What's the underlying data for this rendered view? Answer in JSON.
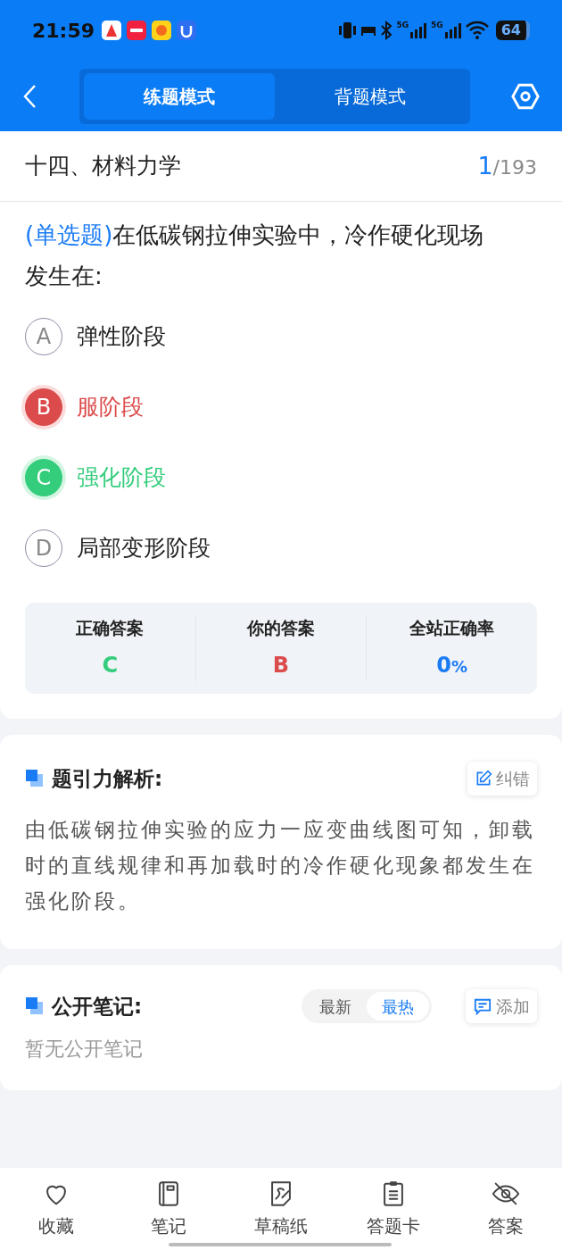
{
  "status_bar": {
    "time": "21:59",
    "signals": [
      "5G",
      "5G"
    ],
    "battery": "64"
  },
  "header": {
    "tabs": [
      {
        "label": "练题模式",
        "selected": true
      },
      {
        "label": "背题模式",
        "selected": false
      }
    ]
  },
  "section": {
    "title": "十四、材料力学",
    "current": "1",
    "total": "/193"
  },
  "question": {
    "type": "(单选题)",
    "text": "在低碳钢拉伸实验中，冷作硬化现场发生在:",
    "options": [
      {
        "letter": "A",
        "text": "弹性阶段",
        "kind": "normal"
      },
      {
        "letter": "B",
        "text": "服阶段",
        "kind": "wrong"
      },
      {
        "letter": "C",
        "text": "强化阶段",
        "kind": "correct"
      },
      {
        "letter": "D",
        "text": "局部变形阶段",
        "kind": "normal"
      }
    ]
  },
  "summary": [
    {
      "label": "正确答案",
      "value": "C",
      "kind": "correct"
    },
    {
      "label": "你的答案",
      "value": "B",
      "kind": "wrong"
    },
    {
      "label": "全站正确率",
      "value": "0",
      "unit": "%",
      "kind": "rate"
    }
  ],
  "analysis": {
    "title": "题引力解析:",
    "action": "纠错",
    "text": "由低碳钢拉伸实验的应力一应变曲线图可知，卸载时的直线规律和再加载时的冷作硬化现象都发生在强化阶段。"
  },
  "notes": {
    "title": "公开笔记:",
    "sort": [
      {
        "label": "最新",
        "selected": false
      },
      {
        "label": "最热",
        "selected": true
      }
    ],
    "action": "添加",
    "empty": "暂无公开笔记"
  },
  "bottom_nav": [
    {
      "label": "收藏",
      "kind": "heart"
    },
    {
      "label": "笔记",
      "kind": "notebook"
    },
    {
      "label": "草稿纸",
      "kind": "draft"
    },
    {
      "label": "答题卡",
      "kind": "card"
    },
    {
      "label": "答案",
      "kind": "eye"
    }
  ]
}
